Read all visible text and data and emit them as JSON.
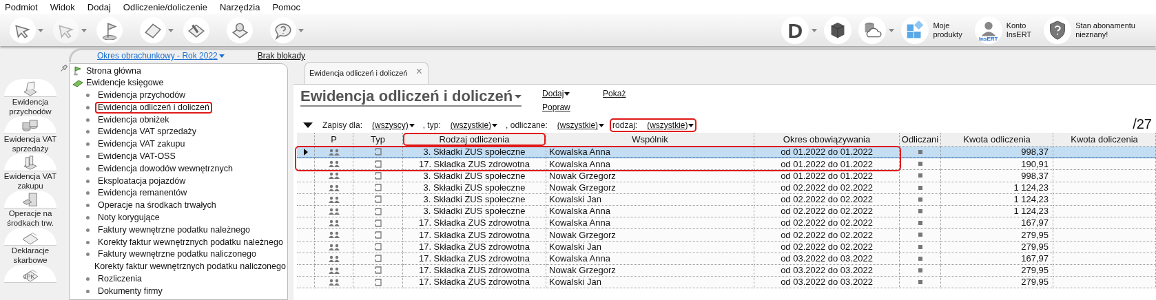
{
  "menu": [
    "Podmiot",
    "Widok",
    "Dodaj",
    "Odliczenie/doliczenie",
    "Narzędzia",
    "Pomoc"
  ],
  "toolbar": {
    "left": [
      {
        "kind": "arrow",
        "dropdown": true,
        "disabled": false
      },
      {
        "kind": "arrow",
        "dropdown": true,
        "disabled": true
      },
      {
        "kind": "flag",
        "dropdown": false,
        "disabled": false
      },
      {
        "kind": "paper",
        "dropdown": true,
        "disabled": false
      },
      {
        "kind": "brush",
        "dropdown": false,
        "disabled": false
      },
      {
        "kind": "stamp",
        "dropdown": false,
        "disabled": false
      },
      {
        "kind": "help",
        "dropdown": true,
        "disabled": false
      }
    ],
    "right": [
      {
        "kind": "letter",
        "text": "D",
        "dropdown": true
      },
      {
        "kind": "cube",
        "dropdown": false
      },
      {
        "kind": "cloud",
        "dropdown": true
      },
      {
        "kind": "tiles",
        "label": "Moje\nprodukty",
        "dropdown": false
      },
      {
        "kind": "person",
        "text": "InsERT",
        "label": "Konto\nInsERT",
        "dropdown": false
      },
      {
        "kind": "shield",
        "label": "Stan abonamentu\nnieznany!",
        "dropdown": false
      }
    ]
  },
  "left_bar": [
    {
      "label": "Ewidencja przychodów",
      "kind": "printer"
    },
    {
      "label": "Ewidencja VAT sprzedaży",
      "kind": "coins"
    },
    {
      "label": "Ewidencja VAT zakupu",
      "kind": "books"
    },
    {
      "label": "Operacje na środkach trw.",
      "kind": "cabinet"
    },
    {
      "label": "Deklaracje skarbowe",
      "kind": "papers"
    },
    {
      "icon_text": "JPK",
      "kind": "papers"
    }
  ],
  "period": {
    "label": "Okres obrachunkowy - Rok 2022",
    "lock": "Brak blokady"
  },
  "sidebar": {
    "items": [
      {
        "label": "Strona główna",
        "kind": "flag"
      },
      {
        "label": "Ewidencje księgowe",
        "kind": "book",
        "children": [
          {
            "label": "Ewidencja przychodów",
            "highlighted": false
          },
          {
            "label": "Ewidencja odliczeń i doliczeń",
            "highlighted": true
          },
          {
            "label": "Ewidencja obniżek",
            "highlighted": false
          },
          {
            "label": "Ewidencja VAT sprzedaży",
            "highlighted": false
          },
          {
            "label": "Ewidencja VAT zakupu",
            "highlighted": false
          },
          {
            "label": "Ewidencja VAT-OSS",
            "highlighted": false
          },
          {
            "label": "Ewidencja dowodów wewnętrznych",
            "highlighted": false
          },
          {
            "label": "Eksploatacja pojazdów",
            "highlighted": false
          },
          {
            "label": "Ewidencja remanentów",
            "highlighted": false
          },
          {
            "label": "Operacje na środkach trwałych",
            "highlighted": false
          },
          {
            "label": "Noty korygujące",
            "highlighted": false
          },
          {
            "label": "Faktury wewnętrzne podatku należnego",
            "highlighted": false
          },
          {
            "label": "Korekty faktur wewnętrznych podatku należnego",
            "highlighted": false
          },
          {
            "label": "Faktury wewnętrzne podatku naliczonego",
            "highlighted": false
          },
          {
            "label": "Korekty faktur wewnętrznych podatku naliczonego",
            "highlighted": false
          },
          {
            "label": "Rozliczenia",
            "highlighted": false
          },
          {
            "label": "Dokumenty firmy",
            "highlighted": false
          }
        ]
      }
    ]
  },
  "tab": {
    "label": "Ewidencja odliczeń i doliczeń",
    "close": "×"
  },
  "title": "Ewidencja odliczeń i doliczeń",
  "actions": [
    {
      "label": "Dodaj",
      "dropdown": true
    },
    {
      "label": "Popraw",
      "dropdown": false
    },
    {
      "label": "Pokaż",
      "dropdown": false
    }
  ],
  "filters": [
    {
      "label": "Zapisy dla:",
      "value": "(wszyscy)",
      "highlighted": false
    },
    {
      "label": ", typ:",
      "value": "(wszystkie)",
      "highlighted": false
    },
    {
      "label": ", odliczane:",
      "value": "(wszystkie)",
      "highlighted": false
    },
    {
      "label": "rodzaj:",
      "value": "(wszystkie)",
      "highlighted": true
    }
  ],
  "count": "/27",
  "table": {
    "columns": [
      {
        "label": "P",
        "highlighted": false
      },
      {
        "label": "Typ",
        "highlighted": false
      },
      {
        "label": "Rodzaj odliczenia",
        "highlighted": true
      },
      {
        "label": "Wspólnik",
        "highlighted": false
      },
      {
        "label": "Okres obowiązywania",
        "highlighted": false
      },
      {
        "label": "Odliczani",
        "highlighted": false
      },
      {
        "label": "Kwota odliczenia",
        "highlighted": false
      },
      {
        "label": "Kwota doliczenia",
        "highlighted": false
      }
    ],
    "rows": [
      {
        "selected": true,
        "highlighted": true,
        "deducted": true,
        "cells": [
          "",
          "",
          "3. Składki ZUS społeczne",
          "Kowalska Anna",
          "od 01.2022 do 01.2022",
          "",
          "998,37",
          ""
        ]
      },
      {
        "selected": false,
        "highlighted": true,
        "deducted": true,
        "cells": [
          "",
          "",
          "17. Składka ZUS zdrowotna",
          "Kowalska Anna",
          "od 01.2022 do 01.2022",
          "",
          "190,91",
          ""
        ]
      },
      {
        "selected": false,
        "highlighted": false,
        "deducted": true,
        "cells": [
          "",
          "",
          "3. Składki ZUS społeczne",
          "Nowak Grzegorz",
          "od 01.2022 do 01.2022",
          "",
          "998,37",
          ""
        ]
      },
      {
        "selected": false,
        "highlighted": false,
        "deducted": true,
        "cells": [
          "",
          "",
          "3. Składki ZUS społeczne",
          "Nowak Grzegorz",
          "od 02.2022 do 02.2022",
          "",
          "1 124,23",
          ""
        ]
      },
      {
        "selected": false,
        "highlighted": false,
        "deducted": true,
        "cells": [
          "",
          "",
          "3. Składki ZUS społeczne",
          "Kowalski Jan",
          "od 02.2022 do 02.2022",
          "",
          "1 124,23",
          ""
        ]
      },
      {
        "selected": false,
        "highlighted": false,
        "deducted": true,
        "cells": [
          "",
          "",
          "3. Składki ZUS społeczne",
          "Kowalska Anna",
          "od 02.2022 do 02.2022",
          "",
          "1 124,23",
          ""
        ]
      },
      {
        "selected": false,
        "highlighted": false,
        "deducted": true,
        "cells": [
          "",
          "",
          "17. Składka ZUS zdrowotna",
          "Kowalska Anna",
          "od 02.2022 do 02.2022",
          "",
          "167,97",
          ""
        ]
      },
      {
        "selected": false,
        "highlighted": false,
        "deducted": true,
        "cells": [
          "",
          "",
          "17. Składka ZUS zdrowotna",
          "Nowak Grzegorz",
          "od 02.2022 do 02.2022",
          "",
          "279,95",
          ""
        ]
      },
      {
        "selected": false,
        "highlighted": false,
        "deducted": true,
        "cells": [
          "",
          "",
          "17. Składka ZUS zdrowotna",
          "Kowalski Jan",
          "od 02.2022 do 02.2022",
          "",
          "279,95",
          ""
        ]
      },
      {
        "selected": false,
        "highlighted": false,
        "deducted": true,
        "cells": [
          "",
          "",
          "17. Składka ZUS zdrowotna",
          "Kowalska Anna",
          "od 03.2022 do 03.2022",
          "",
          "167,97",
          ""
        ]
      },
      {
        "selected": false,
        "highlighted": false,
        "deducted": true,
        "cells": [
          "",
          "",
          "17. Składka ZUS zdrowotna",
          "Nowak Grzegorz",
          "od 03.2022 do 03.2022",
          "",
          "279,95",
          ""
        ]
      },
      {
        "selected": false,
        "highlighted": false,
        "deducted": true,
        "cells": [
          "",
          "",
          "17. Składka ZUS zdrowotna",
          "Kowalski Jan",
          "od 03.2022 do 03.2022",
          "",
          "279,95",
          ""
        ]
      }
    ]
  }
}
